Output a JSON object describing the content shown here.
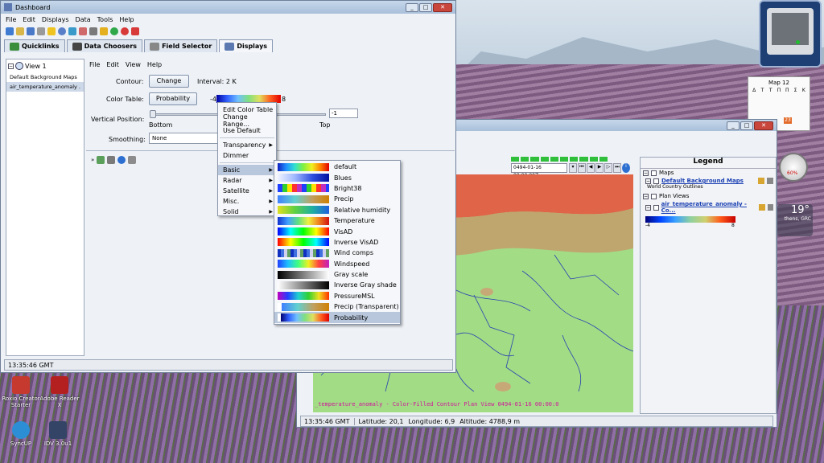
{
  "desktop": {
    "icons": [
      {
        "label": "Roxio Creator Starter"
      },
      {
        "label": "Adobe Reader X"
      },
      {
        "label": "SyncUP"
      },
      {
        "label": "IDV 3.0u1"
      }
    ],
    "calendar": {
      "title": "Map 12",
      "days": [
        "Δ",
        "T",
        "T",
        "Π",
        "Π",
        "Σ",
        "K"
      ],
      "highlight": "23"
    },
    "weather": {
      "temp": "19°",
      "place": "thens, GRC"
    },
    "meter": {
      "percent": "60%"
    }
  },
  "dashboard": {
    "title": "Dashboard",
    "menu": [
      "File",
      "Edit",
      "Displays",
      "Data",
      "Tools",
      "Help"
    ],
    "tabs": [
      "Quicklinks",
      "Data Choosers",
      "Field Selector",
      "Displays"
    ],
    "status": "13:35:46 GMT",
    "tree": {
      "root": "View 1",
      "items": [
        "Default Background Maps",
        "air_temperature_anomaly ."
      ]
    },
    "inner_menu": [
      "File",
      "Edit",
      "View",
      "Help"
    ],
    "form": {
      "contour_label": "Contour:",
      "contour_button": "Change",
      "interval": "Interval: 2 K",
      "colortable_label": "Color Table:",
      "colortable_button": "Probability",
      "ct_min": "-4",
      "ct_max": "8",
      "vertical_label": "Vertical Position:",
      "vertical_value": "-1",
      "bottom": "Bottom",
      "top": "Top",
      "smoothing_label": "Smoothing:",
      "smoothing_value": "None"
    }
  },
  "context_menu": {
    "items": [
      "Edit Color Table",
      "Change Range...",
      "Use Default"
    ],
    "items2": [
      "Transparency",
      "Dimmer"
    ],
    "categories": [
      "Basic",
      "Radar",
      "Satellite",
      "Misc.",
      "Solid"
    ]
  },
  "colortables": [
    "default",
    "Blues",
    "Bright38",
    "Precip",
    "Relative humidity",
    "Temperature",
    "VisAD",
    "Inverse VisAD",
    "Wind comps",
    "Windspeed",
    "Gray scale",
    "Inverse Gray shade",
    "PressureMSL",
    "Precip (Transparent)",
    "Probability"
  ],
  "mapview": {
    "time": "0494-01-16 00:00:00Z",
    "overlay": "_temperature_anomaly - Color-Filled Contour Plan View 0494-01-16 00:00:0",
    "status": {
      "time": "13:35:46 GMT",
      "lat": "Latitude:  20,1",
      "lon": "Longitude:  6,9",
      "alt": "Altitude:  4788,9 m"
    }
  },
  "legend": {
    "title": "Legend",
    "maps_header": "Maps",
    "maps_item": "Default Background Maps",
    "maps_sub": "World Country Outlines",
    "plan_header": "Plan Views",
    "plan_item": "air_temperature_anomaly - Co...",
    "min": "-4",
    "max": "8"
  }
}
